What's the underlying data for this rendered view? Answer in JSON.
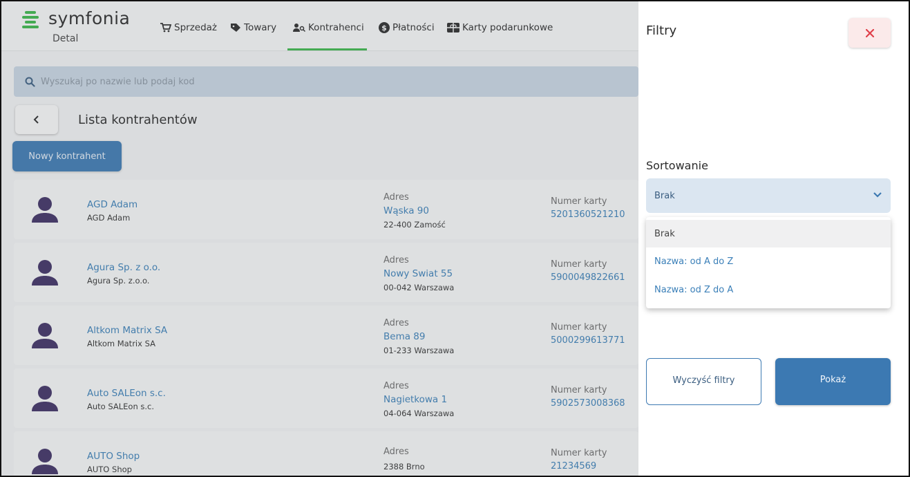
{
  "app": {
    "brand": "symfonia",
    "brand_sub": "Detal"
  },
  "nav": {
    "sales": "Sprzedaż",
    "products": "Towary",
    "contractors": "Kontrahenci",
    "payments": "Płatności",
    "gift_cards": "Karty podarunkowe"
  },
  "search": {
    "placeholder": "Wyszukaj po nazwie lub podaj kod"
  },
  "list": {
    "title": "Lista kontrahentów",
    "new_button": "Nowy kontrahent",
    "rows": [
      {
        "name": "AGD Adam",
        "sub": "AGD Adam",
        "addr_label": "Adres",
        "street": "Wąska 90",
        "city": "22-400 Zamość",
        "card_label": "Numer karty",
        "card": "5201360521210"
      },
      {
        "name": "Agura Sp. z o.o.",
        "sub": "Agura Sp. z.o.o.",
        "addr_label": "Adres",
        "street": "Nowy Swiat 55",
        "city": "00-042 Warszawa",
        "card_label": "Numer karty",
        "card": "5900049822661"
      },
      {
        "name": "Altkom Matrix SA",
        "sub": "Altkom Matrix SA",
        "addr_label": "Adres",
        "street": "Bema 89",
        "city": "01-233 Warszawa",
        "card_label": "Numer karty",
        "card": "5000299613771"
      },
      {
        "name": "Auto SALEon s.c.",
        "sub": "Auto SALEon s.c.",
        "addr_label": "Adres",
        "street": "Nagietkowa 1",
        "city": "04-064 Warszawa",
        "card_label": "Numer karty",
        "card": "5902573008368"
      },
      {
        "name": "AUTO Shop",
        "sub": "AUTO Shop",
        "addr_label": "Adres",
        "street": "",
        "city": "2388 Brno",
        "card_label": "Numer karty",
        "card": "21234569"
      }
    ]
  },
  "filters": {
    "title": "Filtry",
    "sort_label": "Sortowanie",
    "sort_value": "Brak",
    "options": [
      "Brak",
      "Nazwa: od A do Z",
      "Nazwa: od Z do A"
    ],
    "clear_button": "Wyczyść filtry",
    "show_button": "Pokaż"
  },
  "colors": {
    "brand_green": "#3bb64a",
    "primary_blue": "#3c79b2",
    "link_blue": "#3a7fb8",
    "avatar": "#3d2f63",
    "close_red": "#e0404a"
  }
}
